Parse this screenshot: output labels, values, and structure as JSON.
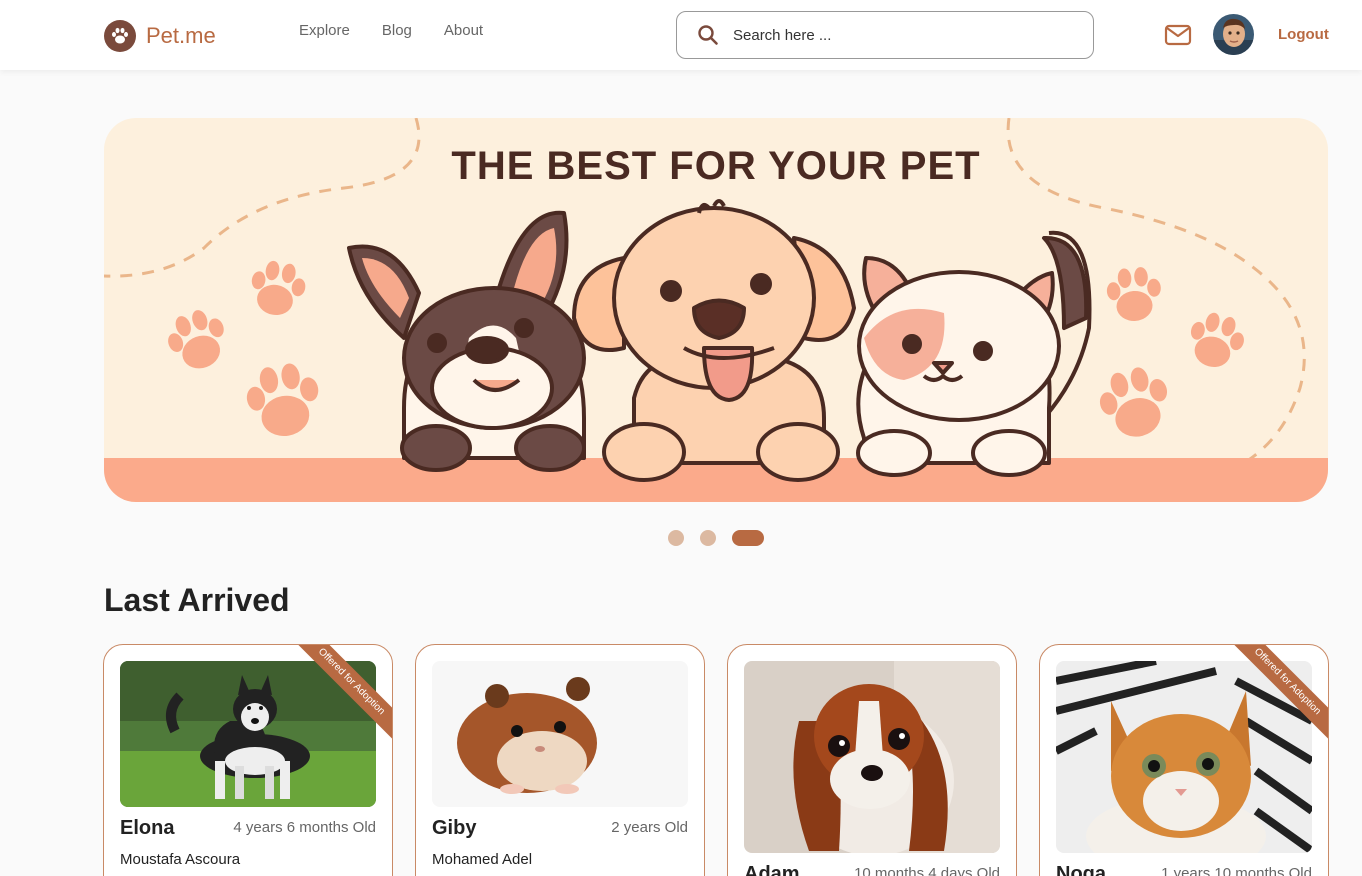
{
  "header": {
    "brand": "Pet.me",
    "nav": [
      "Explore",
      "Blog",
      "About"
    ],
    "search_placeholder": "Search here ...",
    "logout_label": "Logout"
  },
  "hero": {
    "title": "THE BEST FOR YOUR PET",
    "slides_total": 3,
    "active_slide": 3
  },
  "section": {
    "title": "Last Arrived"
  },
  "pets": [
    {
      "name": "Elona",
      "age": "4 years 6 months Old",
      "owner": "Moustafa Ascoura",
      "badge": "Offered for Adoption",
      "kind": "husky"
    },
    {
      "name": "Giby",
      "age": "2 years Old",
      "owner": "Mohamed Adel",
      "badge": "",
      "kind": "hamster"
    },
    {
      "name": "Adam",
      "age": "10 months 4 days Old",
      "owner": "",
      "badge": "",
      "kind": "spaniel"
    },
    {
      "name": "Noga",
      "age": "1 years 10 months Old",
      "owner": "",
      "badge": "Offered for Adoption",
      "kind": "kitten"
    }
  ],
  "colors": {
    "brand": "#b86a42",
    "hero_bg": "#fdf0dd",
    "paw": "#f8aa8a",
    "dark_brown": "#4a2a22"
  }
}
